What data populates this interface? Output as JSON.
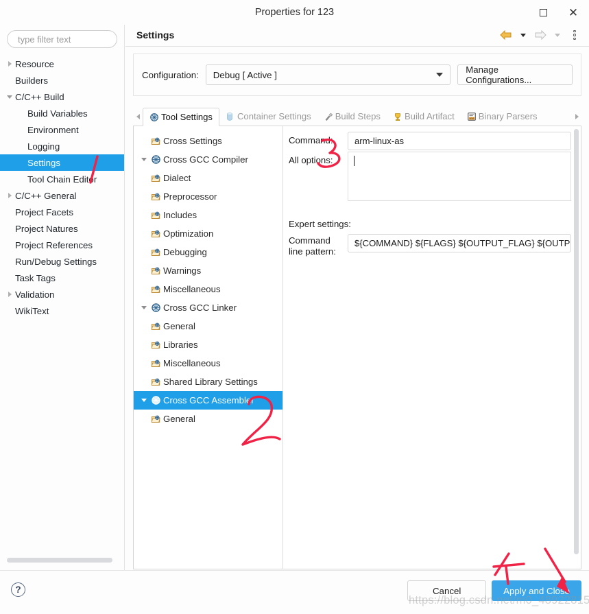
{
  "window": {
    "title": "Properties for 123",
    "maximize_icon": "square-icon",
    "close_icon": "close-icon"
  },
  "sidebar": {
    "filter_placeholder": "type filter text",
    "filter_value": "",
    "items": [
      {
        "label": "Resource",
        "level": 0,
        "twisty": "right",
        "selected": false
      },
      {
        "label": "Builders",
        "level": 0,
        "twisty": "none",
        "selected": false
      },
      {
        "label": "C/C++ Build",
        "level": 0,
        "twisty": "down",
        "selected": false
      },
      {
        "label": "Build Variables",
        "level": 1,
        "twisty": "none",
        "selected": false
      },
      {
        "label": "Environment",
        "level": 1,
        "twisty": "none",
        "selected": false
      },
      {
        "label": "Logging",
        "level": 1,
        "twisty": "none",
        "selected": false
      },
      {
        "label": "Settings",
        "level": 1,
        "twisty": "none",
        "selected": true
      },
      {
        "label": "Tool Chain Editor",
        "level": 1,
        "twisty": "none",
        "selected": false
      },
      {
        "label": "C/C++ General",
        "level": 0,
        "twisty": "right",
        "selected": false
      },
      {
        "label": "Project Facets",
        "level": 0,
        "twisty": "none",
        "selected": false
      },
      {
        "label": "Project Natures",
        "level": 0,
        "twisty": "none",
        "selected": false
      },
      {
        "label": "Project References",
        "level": 0,
        "twisty": "none",
        "selected": false
      },
      {
        "label": "Run/Debug Settings",
        "level": 0,
        "twisty": "none",
        "selected": false
      },
      {
        "label": "Task Tags",
        "level": 0,
        "twisty": "none",
        "selected": false
      },
      {
        "label": "Validation",
        "level": 0,
        "twisty": "right",
        "selected": false
      },
      {
        "label": "WikiText",
        "level": 0,
        "twisty": "none",
        "selected": false
      }
    ]
  },
  "pane": {
    "title": "Settings",
    "toolbar": {
      "back_icon": "arrow-left-icon",
      "back_menu_icon": "chevron-down-icon",
      "forward_icon": "arrow-right-icon",
      "forward_menu_icon": "chevron-down-icon",
      "menu_icon": "vertical-dots-icon"
    },
    "configuration": {
      "label": "Configuration:",
      "value": "Debug  [ Active ]",
      "dropdown_icon": "chevron-down-icon",
      "manage_button": "Manage Configurations..."
    },
    "tabs": {
      "scroll_left_icon": "chevron-left-icon",
      "scroll_right_icon": "chevron-right-icon",
      "items": [
        {
          "label": "Tool Settings",
          "icon": "tool-settings-icon",
          "active": true,
          "enabled": true
        },
        {
          "label": "Container Settings",
          "icon": "container-icon",
          "active": false,
          "enabled": false
        },
        {
          "label": "Build Steps",
          "icon": "build-steps-icon",
          "active": false,
          "enabled": true
        },
        {
          "label": "Build Artifact",
          "icon": "build-artifact-icon",
          "active": false,
          "enabled": true
        },
        {
          "label": "Binary Parsers",
          "icon": "binary-parsers-icon",
          "active": false,
          "enabled": true
        }
      ]
    },
    "tool_tree": [
      {
        "label": "Cross Settings",
        "level": 1,
        "twisty": "none",
        "icon": "folder-gear-icon",
        "selected": false
      },
      {
        "label": "Cross GCC Compiler",
        "level": 0,
        "twisty": "down",
        "icon": "globe-gear-icon",
        "selected": false
      },
      {
        "label": "Dialect",
        "level": 1,
        "twisty": "none",
        "icon": "folder-gear-icon",
        "selected": false
      },
      {
        "label": "Preprocessor",
        "level": 1,
        "twisty": "none",
        "icon": "folder-gear-icon",
        "selected": false
      },
      {
        "label": "Includes",
        "level": 1,
        "twisty": "none",
        "icon": "folder-gear-icon",
        "selected": false
      },
      {
        "label": "Optimization",
        "level": 1,
        "twisty": "none",
        "icon": "folder-gear-icon",
        "selected": false
      },
      {
        "label": "Debugging",
        "level": 1,
        "twisty": "none",
        "icon": "folder-gear-icon",
        "selected": false
      },
      {
        "label": "Warnings",
        "level": 1,
        "twisty": "none",
        "icon": "folder-gear-icon",
        "selected": false
      },
      {
        "label": "Miscellaneous",
        "level": 1,
        "twisty": "none",
        "icon": "folder-gear-icon",
        "selected": false
      },
      {
        "label": "Cross GCC Linker",
        "level": 0,
        "twisty": "down",
        "icon": "globe-gear-icon",
        "selected": false
      },
      {
        "label": "General",
        "level": 1,
        "twisty": "none",
        "icon": "folder-gear-icon",
        "selected": false
      },
      {
        "label": "Libraries",
        "level": 1,
        "twisty": "none",
        "icon": "folder-gear-icon",
        "selected": false
      },
      {
        "label": "Miscellaneous",
        "level": 1,
        "twisty": "none",
        "icon": "folder-gear-icon",
        "selected": false
      },
      {
        "label": "Shared Library Settings",
        "level": 1,
        "twisty": "none",
        "icon": "folder-gear-icon",
        "selected": false
      },
      {
        "label": "Cross GCC Assembler",
        "level": 0,
        "twisty": "down",
        "icon": "globe-gear-icon",
        "selected": true
      },
      {
        "label": "General",
        "level": 1,
        "twisty": "none",
        "icon": "folder-gear-icon",
        "selected": false
      }
    ],
    "form": {
      "command_label": "Command:",
      "command_value": "arm-linux-as",
      "all_options_label": "All options:",
      "all_options_value": "",
      "expert_label": "Expert settings:",
      "pattern_label_line1": "Command",
      "pattern_label_line2": "line pattern:",
      "pattern_value": "${COMMAND} ${FLAGS} ${OUTPUT_FLAG} ${OUTPI"
    }
  },
  "footer": {
    "help_icon": "help-icon",
    "cancel_label": "Cancel",
    "apply_label": "Apply and Close"
  },
  "annotations": {
    "mark_1": "1",
    "mark_2": "2",
    "mark_3": "3",
    "mark_4": "4",
    "color": "#f02246",
    "watermark": "https://blog.csdn.net/m0_48922815"
  }
}
